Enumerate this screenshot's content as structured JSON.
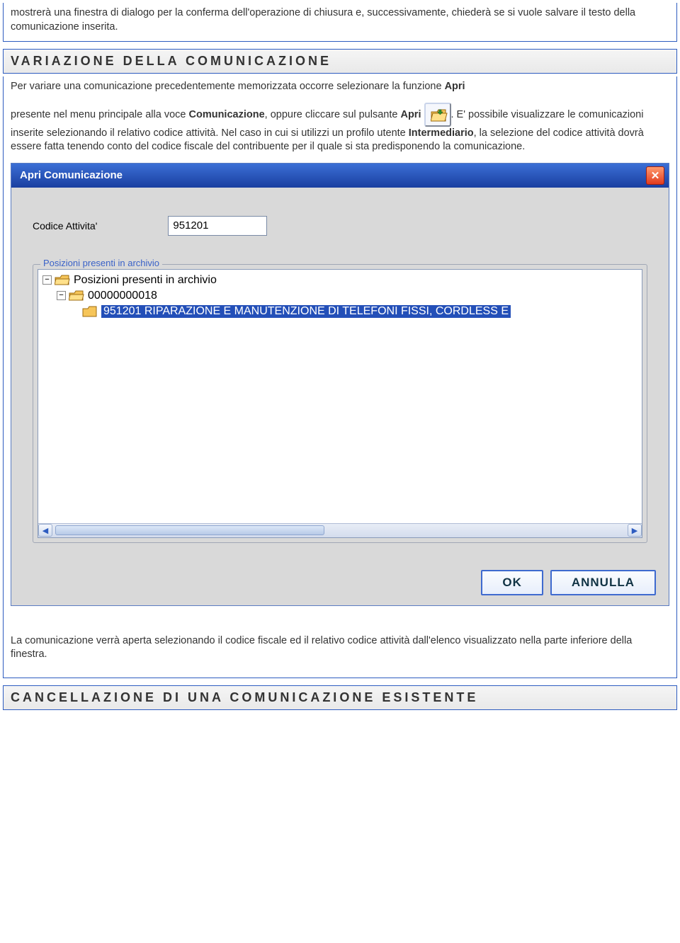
{
  "intro": "mostrerà una finestra di dialogo per la conferma dell'operazione di chiusura e, successivamente, chiederà se si vuole salvare il testo della comunicazione inserita.",
  "section1": {
    "title": "VARIAZIONE DELLA COMUNICAZIONE",
    "para1_a": "Per variare una comunicazione precedentemente memorizzata occorre selezionare la funzione ",
    "para1_b": "Apri",
    "para2_a": "presente nel menu principale alla voce ",
    "para2_b": "Comunicazione",
    "para2_c": ", oppure cliccare sul pulsante ",
    "para2_d": "Apri",
    "para2_e": " ",
    "para2_f": ". E' possibile visualizzare le comunicazioni inserite selezionando il relativo codice attività. Nel caso in cui si utilizzi un profilo utente ",
    "para2_g": "Intermediario",
    "para2_h": ", la selezione del codice attività dovrà essere fatta tenendo conto del codice fiscale del contribuente per il quale si sta predisponendo la comunicazione.",
    "footer": "La comunicazione verrà aperta selezionando il codice fiscale ed il relativo codice attività dall'elenco visualizzato nella parte inferiore della finestra."
  },
  "dialog": {
    "title": "Apri Comunicazione",
    "field_label": "Codice Attivita'",
    "field_value": "951201",
    "group_legend": "Posizioni presenti in archivio",
    "tree": {
      "root": "Posizioni presenti in archivio",
      "node1": "00000000018",
      "leaf1": "951201 RIPARAZIONE E MANUTENZIONE DI TELEFONI FISSI, CORDLESS E"
    },
    "ok": "OK",
    "cancel": "ANNULLA"
  },
  "section2": {
    "title": "CANCELLAZIONE DI UNA COMUNICAZIONE ESISTENTE"
  }
}
